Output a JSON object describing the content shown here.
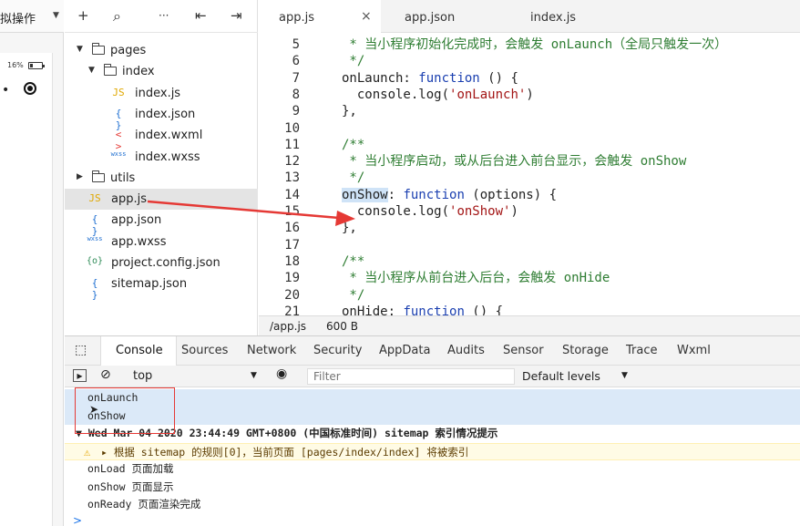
{
  "simulator": {
    "title": "拟操作",
    "battery": "16%"
  },
  "tree_toolbar": {
    "icons": [
      "plus-icon",
      "search-icon",
      "more-icon",
      "outdent-icon",
      "split-icon"
    ],
    "glyphs": [
      "+",
      "⌕",
      "···",
      "⇤",
      "⇥"
    ]
  },
  "tree": [
    {
      "type": "folder",
      "label": "pages",
      "expanded": true,
      "depth": 0
    },
    {
      "type": "folder",
      "label": "index",
      "expanded": true,
      "depth": 1
    },
    {
      "type": "js",
      "label": "index.js",
      "depth": 2
    },
    {
      "type": "json",
      "label": "index.json",
      "depth": 2
    },
    {
      "type": "wxml",
      "label": "index.wxml",
      "depth": 2
    },
    {
      "type": "wxss",
      "label": "index.wxss",
      "depth": 2
    },
    {
      "type": "folder",
      "label": "utils",
      "expanded": false,
      "depth": 0
    },
    {
      "type": "js",
      "label": "app.js",
      "depth": 0,
      "selected": true
    },
    {
      "type": "json",
      "label": "app.json",
      "depth": 0
    },
    {
      "type": "wxss",
      "label": "app.wxss",
      "depth": 0
    },
    {
      "type": "config",
      "label": "project.config.json",
      "depth": 0
    },
    {
      "type": "json",
      "label": "sitemap.json",
      "depth": 0
    }
  ],
  "file_icons": {
    "js": "JS",
    "json": "{ }",
    "wxml": "< >",
    "wxss": "wxss",
    "config": "{o}"
  },
  "editor_tabs": [
    {
      "label": "app.js",
      "active": true,
      "close": "×"
    },
    {
      "label": "app.json",
      "active": false
    },
    {
      "label": "index.js",
      "active": false
    }
  ],
  "code_lines": [
    {
      "n": "5",
      "parts": [
        {
          "t": " * 当小程序初始化完成时，会触发 onLaunch（全局只触发一次）",
          "c": "c-comment"
        }
      ]
    },
    {
      "n": "6",
      "parts": [
        {
          "t": " */",
          "c": "c-comment"
        }
      ]
    },
    {
      "n": "7",
      "parts": [
        {
          "t": "onLaunch: ",
          "c": ""
        },
        {
          "t": "function",
          "c": "c-kw"
        },
        {
          "t": " () {",
          "c": ""
        }
      ]
    },
    {
      "n": "8",
      "parts": [
        {
          "t": "  console.log(",
          "c": ""
        },
        {
          "t": "'onLaunch'",
          "c": "c-str"
        },
        {
          "t": ")",
          "c": ""
        }
      ]
    },
    {
      "n": "9",
      "parts": [
        {
          "t": "},",
          "c": ""
        }
      ]
    },
    {
      "n": "10",
      "parts": []
    },
    {
      "n": "11",
      "parts": [
        {
          "t": "/**",
          "c": "c-comment"
        }
      ]
    },
    {
      "n": "12",
      "parts": [
        {
          "t": " * 当小程序启动，或从后台进入前台显示，会触发 onShow",
          "c": "c-comment"
        }
      ]
    },
    {
      "n": "13",
      "parts": [
        {
          "t": " */",
          "c": "c-comment"
        }
      ]
    },
    {
      "n": "14",
      "parts": [
        {
          "t": "onShow",
          "c": "c-hl"
        },
        {
          "t": ": ",
          "c": ""
        },
        {
          "t": "function",
          "c": "c-kw"
        },
        {
          "t": " (options) {",
          "c": ""
        }
      ]
    },
    {
      "n": "15",
      "parts": [
        {
          "t": "  console.log(",
          "c": ""
        },
        {
          "t": "'onShow'",
          "c": "c-str"
        },
        {
          "t": ")",
          "c": ""
        }
      ]
    },
    {
      "n": "16",
      "parts": [
        {
          "t": "},",
          "c": ""
        }
      ]
    },
    {
      "n": "17",
      "parts": []
    },
    {
      "n": "18",
      "parts": [
        {
          "t": "/**",
          "c": "c-comment"
        }
      ]
    },
    {
      "n": "19",
      "parts": [
        {
          "t": " * 当小程序从前台进入后台，会触发 onHide",
          "c": "c-comment"
        }
      ]
    },
    {
      "n": "20",
      "parts": [
        {
          "t": " */",
          "c": "c-comment"
        }
      ]
    },
    {
      "n": "21",
      "parts": [
        {
          "t": "onHide: ",
          "c": ""
        },
        {
          "t": "function",
          "c": "c-kw"
        },
        {
          "t": " () {",
          "c": ""
        }
      ]
    }
  ],
  "statusbar": {
    "path": "/app.js",
    "size": "600 B"
  },
  "devtools": {
    "tabs": [
      "Console",
      "Sources",
      "Network",
      "Security",
      "AppData",
      "Audits",
      "Sensor",
      "Storage",
      "Trace",
      "Wxml"
    ],
    "active_tab": "Console",
    "context": "top",
    "filter_placeholder": "Filter",
    "levels": "Default levels",
    "logs": [
      {
        "text": "onLaunch",
        "kind": "selected"
      },
      {
        "text": "onShow",
        "kind": "selected"
      },
      {
        "text": "▼ Wed Mar 04 2020 23:44:49 GMT+0800 (中国标准时间) sitemap 索引情况提示",
        "kind": "group"
      },
      {
        "text": "▸ 根据 sitemap 的规则[0]，当前页面 [pages/index/index] 将被索引",
        "kind": "warn"
      },
      {
        "text": "onLoad 页面加载",
        "kind": "plain"
      },
      {
        "text": "onShow 页面显示",
        "kind": "plain"
      },
      {
        "text": "onReady 页面渲染完成",
        "kind": "plain"
      }
    ],
    "prompt": ">"
  },
  "colors": {
    "annotation": "#e53935",
    "selection": "#dbe9f8",
    "warning": "#e6a700"
  }
}
